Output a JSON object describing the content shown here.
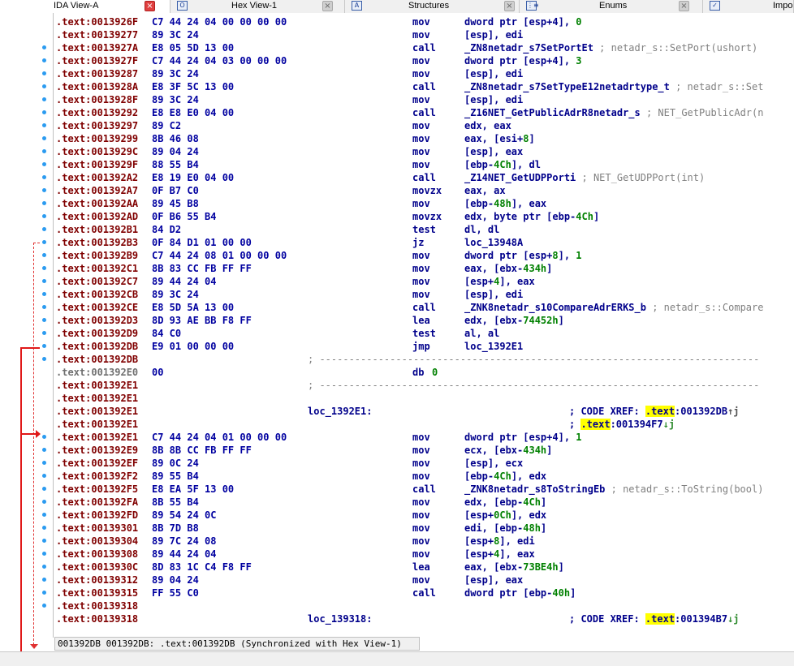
{
  "tabs": [
    {
      "label": "IDA View-A",
      "active": true,
      "icon": "",
      "close": "red"
    },
    {
      "label": "Hex View-1",
      "icon": "O",
      "close": "grey"
    },
    {
      "label": "Structures",
      "icon": "A",
      "close": "grey"
    },
    {
      "label": "Enums",
      "icon": "⋮≡",
      "close": "grey"
    },
    {
      "label": "Impo",
      "icon": "✓",
      "close": ""
    }
  ],
  "close_glyph": "×",
  "colors": {
    "address": "#800000",
    "bytes": "#0000a0",
    "mnemonic": "#00008b",
    "comment": "#808080",
    "number": "#008000",
    "flow_arrow": "#e01818",
    "breakpoint_dot": "#2b9bf0",
    "highlight": "#ffff00"
  },
  "listing": [
    {
      "addr": ".text:0013926F",
      "bytes": "C7 44 24 04 00 00 00 00",
      "mnem": "mov",
      "ops": "dword ptr [esp+4], ",
      "num": "0"
    },
    {
      "addr": ".text:00139277",
      "bytes": "89 3C 24",
      "mnem": "mov",
      "ops": "[esp], edi"
    },
    {
      "addr": ".text:0013927A",
      "bytes": "E8 05 5D 13 00",
      "mnem": "call",
      "ops": "_ZN8netadr_s7SetPortEt",
      "cmt": " ; netadr_s::SetPort(ushort)"
    },
    {
      "addr": ".text:0013927F",
      "bytes": "C7 44 24 04 03 00 00 00",
      "mnem": "mov",
      "ops": "dword ptr [esp+4], ",
      "num": "3"
    },
    {
      "addr": ".text:00139287",
      "bytes": "89 3C 24",
      "mnem": "mov",
      "ops": "[esp], edi"
    },
    {
      "addr": ".text:0013928A",
      "bytes": "E8 3F 5C 13 00",
      "mnem": "call",
      "ops": "_ZN8netadr_s7SetTypeE12netadrtype_t",
      "cmt": " ; netadr_s::Set"
    },
    {
      "addr": ".text:0013928F",
      "bytes": "89 3C 24",
      "mnem": "mov",
      "ops": "[esp], edi"
    },
    {
      "addr": ".text:00139292",
      "bytes": "E8 E8 E0 04 00",
      "mnem": "call",
      "ops": "_Z16NET_GetPublicAdrR8netadr_s",
      "cmt": " ; NET_GetPublicAdr(n"
    },
    {
      "addr": ".text:00139297",
      "bytes": "89 C2",
      "mnem": "mov",
      "ops": "edx, eax"
    },
    {
      "addr": ".text:00139299",
      "bytes": "8B 46 08",
      "mnem": "mov",
      "ops": "eax, [esi+",
      "num": "8",
      "ops2": "]"
    },
    {
      "addr": ".text:0013929C",
      "bytes": "89 04 24",
      "mnem": "mov",
      "ops": "[esp], eax"
    },
    {
      "addr": ".text:0013929F",
      "bytes": "88 55 B4",
      "mnem": "mov",
      "ops": "[ebp-",
      "num": "4Ch",
      "ops2": "], dl"
    },
    {
      "addr": ".text:001392A2",
      "bytes": "E8 19 E0 04 00",
      "mnem": "call",
      "ops": "_Z14NET_GetUDPPorti",
      "cmt": " ; NET_GetUDPPort(int)"
    },
    {
      "addr": ".text:001392A7",
      "bytes": "0F B7 C0",
      "mnem": "movzx",
      "ops": "eax, ax"
    },
    {
      "addr": ".text:001392AA",
      "bytes": "89 45 B8",
      "mnem": "mov",
      "ops": "[ebp-",
      "num": "48h",
      "ops2": "], eax"
    },
    {
      "addr": ".text:001392AD",
      "bytes": "0F B6 55 B4",
      "mnem": "movzx",
      "ops": "edx, byte ptr [ebp-",
      "num": "4Ch",
      "ops2": "]"
    },
    {
      "addr": ".text:001392B1",
      "bytes": "84 D2",
      "mnem": "test",
      "ops": "dl, dl"
    },
    {
      "addr": ".text:001392B3",
      "bytes": "0F 84 D1 01 00 00",
      "mnem": "jz",
      "ops": "loc_13948A"
    },
    {
      "addr": ".text:001392B9",
      "bytes": "C7 44 24 08 01 00 00 00",
      "mnem": "mov",
      "ops": "dword ptr [esp+",
      "num": "8",
      "ops2": "], ",
      "num2": "1"
    },
    {
      "addr": ".text:001392C1",
      "bytes": "8B 83 CC FB FF FF",
      "mnem": "mov",
      "ops": "eax, [ebx-",
      "num": "434h",
      "ops2": "]"
    },
    {
      "addr": ".text:001392C7",
      "bytes": "89 44 24 04",
      "mnem": "mov",
      "ops": "[esp+",
      "num": "4",
      "ops2": "], eax"
    },
    {
      "addr": ".text:001392CB",
      "bytes": "89 3C 24",
      "mnem": "mov",
      "ops": "[esp], edi"
    },
    {
      "addr": ".text:001392CE",
      "bytes": "E8 5D 5A 13 00",
      "mnem": "call",
      "ops": "_ZNK8netadr_s10CompareAdrERKS_b",
      "cmt": " ; netadr_s::Compare"
    },
    {
      "addr": ".text:001392D3",
      "bytes": "8D 93 AE BB F8 FF",
      "mnem": "lea",
      "ops": "edx, [ebx-",
      "num": "74452h",
      "ops2": "]"
    },
    {
      "addr": ".text:001392D9",
      "bytes": "84 C0",
      "mnem": "test",
      "ops": "al, al"
    },
    {
      "addr": ".text:001392DB",
      "bytes": "E9 01 00 00 00",
      "mnem": "jmp",
      "ops": "loc_1392E1"
    },
    {
      "addr": ".text:001392DB",
      "sep": "; ---------------------------------------------------------------------------"
    },
    {
      "addr": ".text:001392E0",
      "grey": true,
      "bytes": "00",
      "mnem": "db ",
      "num": "0"
    },
    {
      "addr": ".text:001392E1",
      "sep": "; ---------------------------------------------------------------------------"
    },
    {
      "addr": ".text:001392E1"
    },
    {
      "addr": ".text:001392E1",
      "label": "loc_1392E1:",
      "xref": "; CODE XREF: ",
      "xhl": ".text",
      "xrest": ":001392DB",
      "arrow": "↑j"
    },
    {
      "addr": ".text:001392E1",
      "xref": "; ",
      "xhl": ".text",
      "xrest": ":001394F7",
      "arrow": "↓j"
    },
    {
      "addr": ".text:001392E1",
      "bytes": "C7 44 24 04 01 00 00 00",
      "mnem": "mov",
      "ops": "dword ptr [esp+4], ",
      "num": "1"
    },
    {
      "addr": ".text:001392E9",
      "bytes": "8B 8B CC FB FF FF",
      "mnem": "mov",
      "ops": "ecx, [ebx-",
      "num": "434h",
      "ops2": "]"
    },
    {
      "addr": ".text:001392EF",
      "bytes": "89 0C 24",
      "mnem": "mov",
      "ops": "[esp], ecx"
    },
    {
      "addr": ".text:001392F2",
      "bytes": "89 55 B4",
      "mnem": "mov",
      "ops": "[ebp-",
      "num": "4Ch",
      "ops2": "], edx"
    },
    {
      "addr": ".text:001392F5",
      "bytes": "E8 EA 5F 13 00",
      "mnem": "call",
      "ops": "_ZNK8netadr_s8ToStringEb",
      "cmt": " ; netadr_s::ToString(bool)"
    },
    {
      "addr": ".text:001392FA",
      "bytes": "8B 55 B4",
      "mnem": "mov",
      "ops": "edx, [ebp-",
      "num": "4Ch",
      "ops2": "]"
    },
    {
      "addr": ".text:001392FD",
      "bytes": "89 54 24 0C",
      "mnem": "mov",
      "ops": "[esp+",
      "num": "0Ch",
      "ops2": "], edx"
    },
    {
      "addr": ".text:00139301",
      "bytes": "8B 7D B8",
      "mnem": "mov",
      "ops": "edi, [ebp-",
      "num": "48h",
      "ops2": "]"
    },
    {
      "addr": ".text:00139304",
      "bytes": "89 7C 24 08",
      "mnem": "mov",
      "ops": "[esp+",
      "num": "8",
      "ops2": "], edi"
    },
    {
      "addr": ".text:00139308",
      "bytes": "89 44 24 04",
      "mnem": "mov",
      "ops": "[esp+",
      "num": "4",
      "ops2": "], eax"
    },
    {
      "addr": ".text:0013930C",
      "bytes": "8D 83 1C C4 F8 FF",
      "mnem": "lea",
      "ops": "eax, [ebx-",
      "num": "73BE4h",
      "ops2": "]"
    },
    {
      "addr": ".text:00139312",
      "bytes": "89 04 24",
      "mnem": "mov",
      "ops": "[esp], eax"
    },
    {
      "addr": ".text:00139315",
      "bytes": "FF 55 C0",
      "mnem": "call",
      "ops": "dword ptr [ebp-",
      "num": "40h",
      "ops2": "]"
    },
    {
      "addr": ".text:00139318"
    },
    {
      "addr": ".text:00139318",
      "label": "loc_139318:",
      "xref": "; CODE XREF: ",
      "xhl": ".text",
      "xrest": ":001394B7",
      "arrow": "↓j"
    }
  ],
  "status": {
    "text": "001392DB 001392DB: .text:001392DB (Synchronized with Hex View-1)"
  }
}
